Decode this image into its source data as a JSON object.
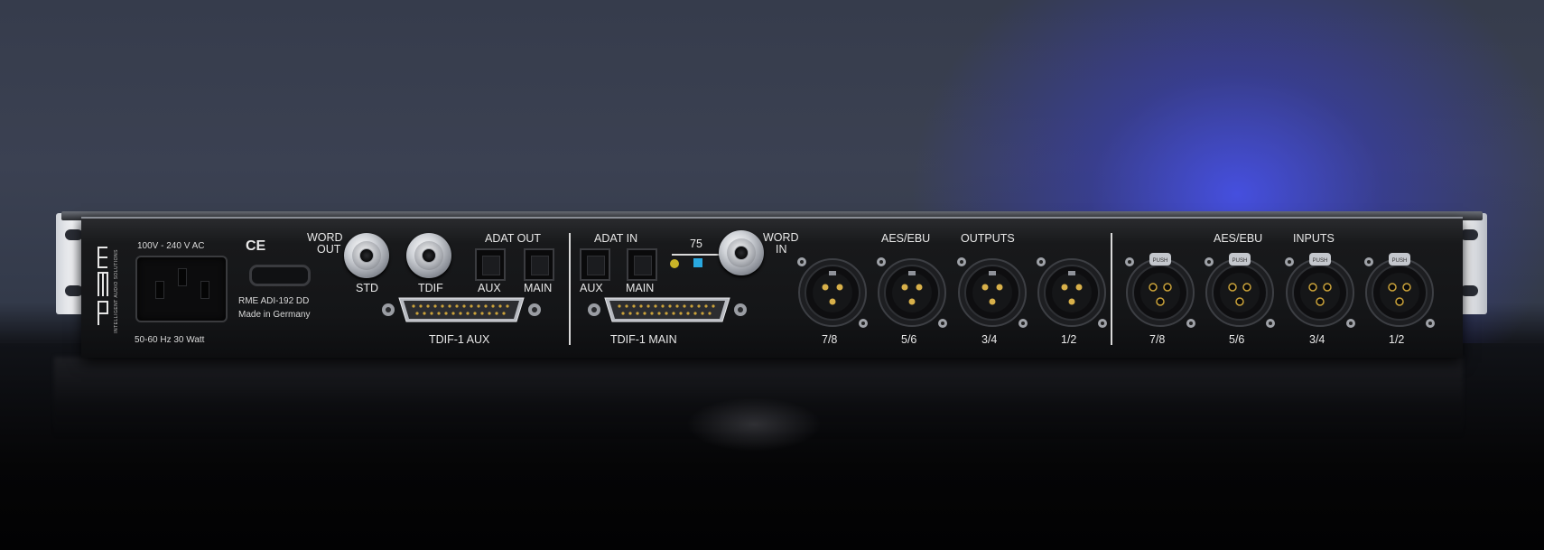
{
  "device": {
    "brand_logo": "RME",
    "logo_tagline": "INTELLIGENT AUDIO SOLUTIONS",
    "power_rating": "100V - 240 V AC",
    "power_frequency": "50-60 Hz  30 Watt",
    "ce_mark": "CE",
    "model": "RME ADI-192 DD",
    "origin": "Made in Germany"
  },
  "labels": {
    "word": "WORD",
    "out": "OUT",
    "std": "STD",
    "tdif": "TDIF",
    "adat_out": "ADAT OUT",
    "adat_in": "ADAT IN",
    "aux": "AUX",
    "main": "MAIN",
    "aux_2": "AUX",
    "main_2": "MAIN",
    "termination": "75",
    "word_in_1": "WORD",
    "word_in_2": "IN",
    "tdif_aux": "TDIF-1 AUX",
    "tdif_main": "TDIF-1 MAIN",
    "aes_ebu_out": "AES/EBU",
    "outputs": "OUTPUTS",
    "aes_ebu_in": "AES/EBU",
    "inputs": "INPUTS"
  },
  "outputs_channels": [
    "7/8",
    "5/6",
    "3/4",
    "1/2"
  ],
  "inputs_channels": [
    "7/8",
    "5/6",
    "3/4",
    "1/2"
  ],
  "xlr_latch_text": "PUSH",
  "colors": {
    "background_glow": "#4650e6",
    "panel": "#151618",
    "label_text": "#e8e8e8",
    "led_yellow": "#c9b428",
    "led_blue": "#29a8e0"
  }
}
